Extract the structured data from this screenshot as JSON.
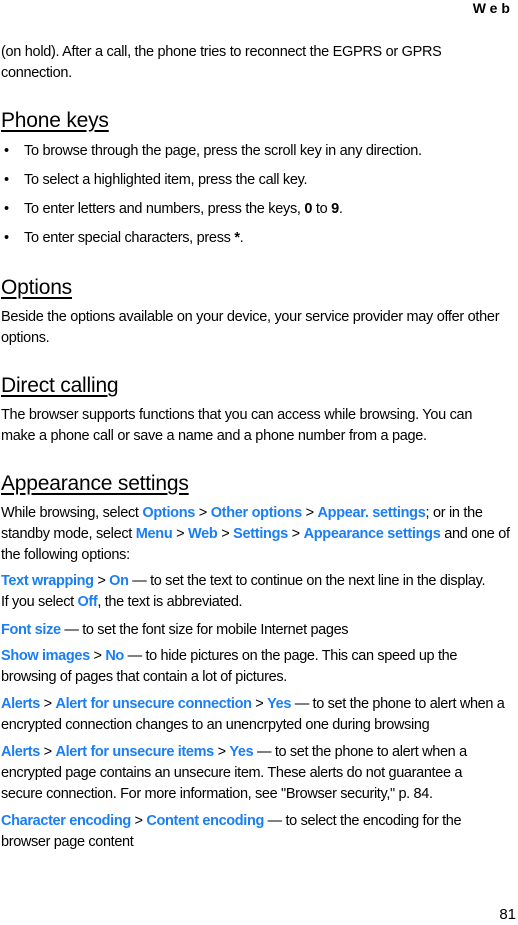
{
  "header": {
    "section": "Web"
  },
  "page_number": "81",
  "intro": {
    "line1": "(on hold). After a call, the phone tries to reconnect the EGPRS or GPRS",
    "line2": "connection."
  },
  "phone_keys": {
    "title": "Phone keys",
    "bullets": [
      {
        "text": "To browse through the page, press the scroll key in any direction."
      },
      {
        "text": "To select a highlighted item, press the call key."
      },
      {
        "pre": "To enter letters and numbers, press the keys, ",
        "key1": "0",
        "mid": " to ",
        "key2": "9",
        "post": "."
      },
      {
        "pre": "To enter special characters, press ",
        "key1": "*",
        "post": "."
      }
    ]
  },
  "options": {
    "title": "Options",
    "line1": "Beside the options available on your device, your service provider may offer other",
    "line2": "options."
  },
  "direct_calling": {
    "title": "Direct calling",
    "line1": "The browser supports functions that you can access while browsing. You can",
    "line2": "make a phone call or save a name and a phone number from a page."
  },
  "appearance": {
    "title": "Appearance settings",
    "l1_pre": "While browsing, select ",
    "path1": [
      "Options",
      "Other options",
      "Appear. settings"
    ],
    "l1_post": "; or in the",
    "l2_pre": "standby mode, select ",
    "path2": [
      "Menu",
      "Web",
      "Settings",
      "Appearance settings"
    ],
    "l2_post": " and one of",
    "l3": "the following options:",
    "sep": " > ",
    "items": [
      {
        "k1": "Text wrapping",
        "k2": "On",
        "desc": " — to set the text to continue on the next line in the display.",
        "l2_pre": "If you select ",
        "l2_k": "Off",
        "l2_post": ", the text is abbreviated."
      },
      {
        "k1": "Font size",
        "desc": " — to set the font size for mobile Internet pages"
      },
      {
        "k1": "Show images",
        "k2": "No",
        "desc": " — to hide pictures on the page. This can speed up the",
        "l2": "browsing of pages that contain a lot of pictures."
      },
      {
        "k1": "Alerts",
        "k2": "Alert for unsecure connection",
        "k3": "Yes",
        "desc": " — to set the phone to alert when a",
        "l2": "encrypted connection changes to an unencrpyted one during browsing"
      },
      {
        "k1": "Alerts",
        "k2": "Alert for unsecure items",
        "k3": "Yes",
        "desc": " — to set the phone to alert when a",
        "l2": "encrypted page contains an unsecure item. These alerts do not guarantee a",
        "l3": "secure connection. For more information, see \"Browser security,\" p. 84."
      },
      {
        "k1": "Character encoding",
        "k2": "Content encoding",
        "desc": " — to select the encoding for the",
        "l2": "browser page content"
      }
    ]
  },
  "colors": {
    "link": "#1a7ef5",
    "text": "#000000"
  }
}
